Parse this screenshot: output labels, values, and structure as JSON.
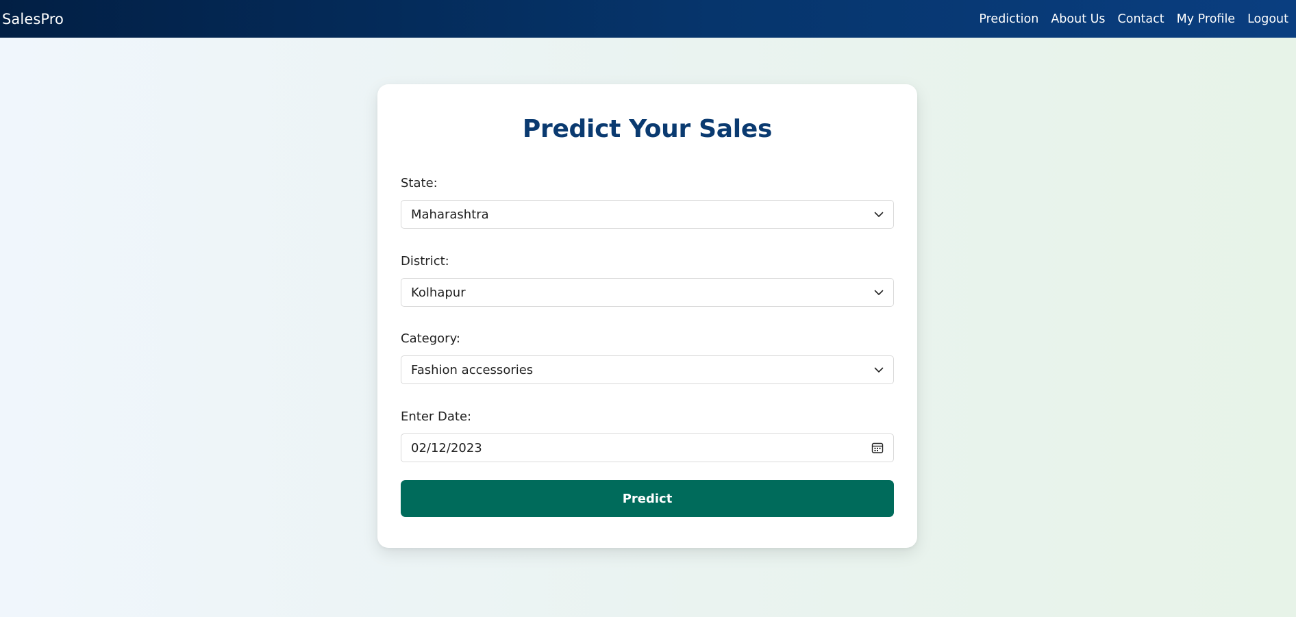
{
  "header": {
    "brand": "SalesPro",
    "nav": [
      {
        "label": "Prediction"
      },
      {
        "label": "About Us"
      },
      {
        "label": "Contact"
      },
      {
        "label": "My Profile"
      },
      {
        "label": "Logout"
      }
    ]
  },
  "form": {
    "title": "Predict Your Sales",
    "state": {
      "label": "State:",
      "value": "Maharashtra"
    },
    "district": {
      "label": "District:",
      "value": "Kolhapur"
    },
    "category": {
      "label": "Category:",
      "value": "Fashion accessories"
    },
    "date": {
      "label": "Enter Date:",
      "value": "02/12/2023"
    },
    "submit_label": "Predict"
  },
  "icons": {
    "dropdown": "chevron-down-icon",
    "date": "calendar-icon"
  },
  "colors": {
    "navbar": "#06356c",
    "title": "#0a3a70",
    "button": "#006b5b"
  }
}
